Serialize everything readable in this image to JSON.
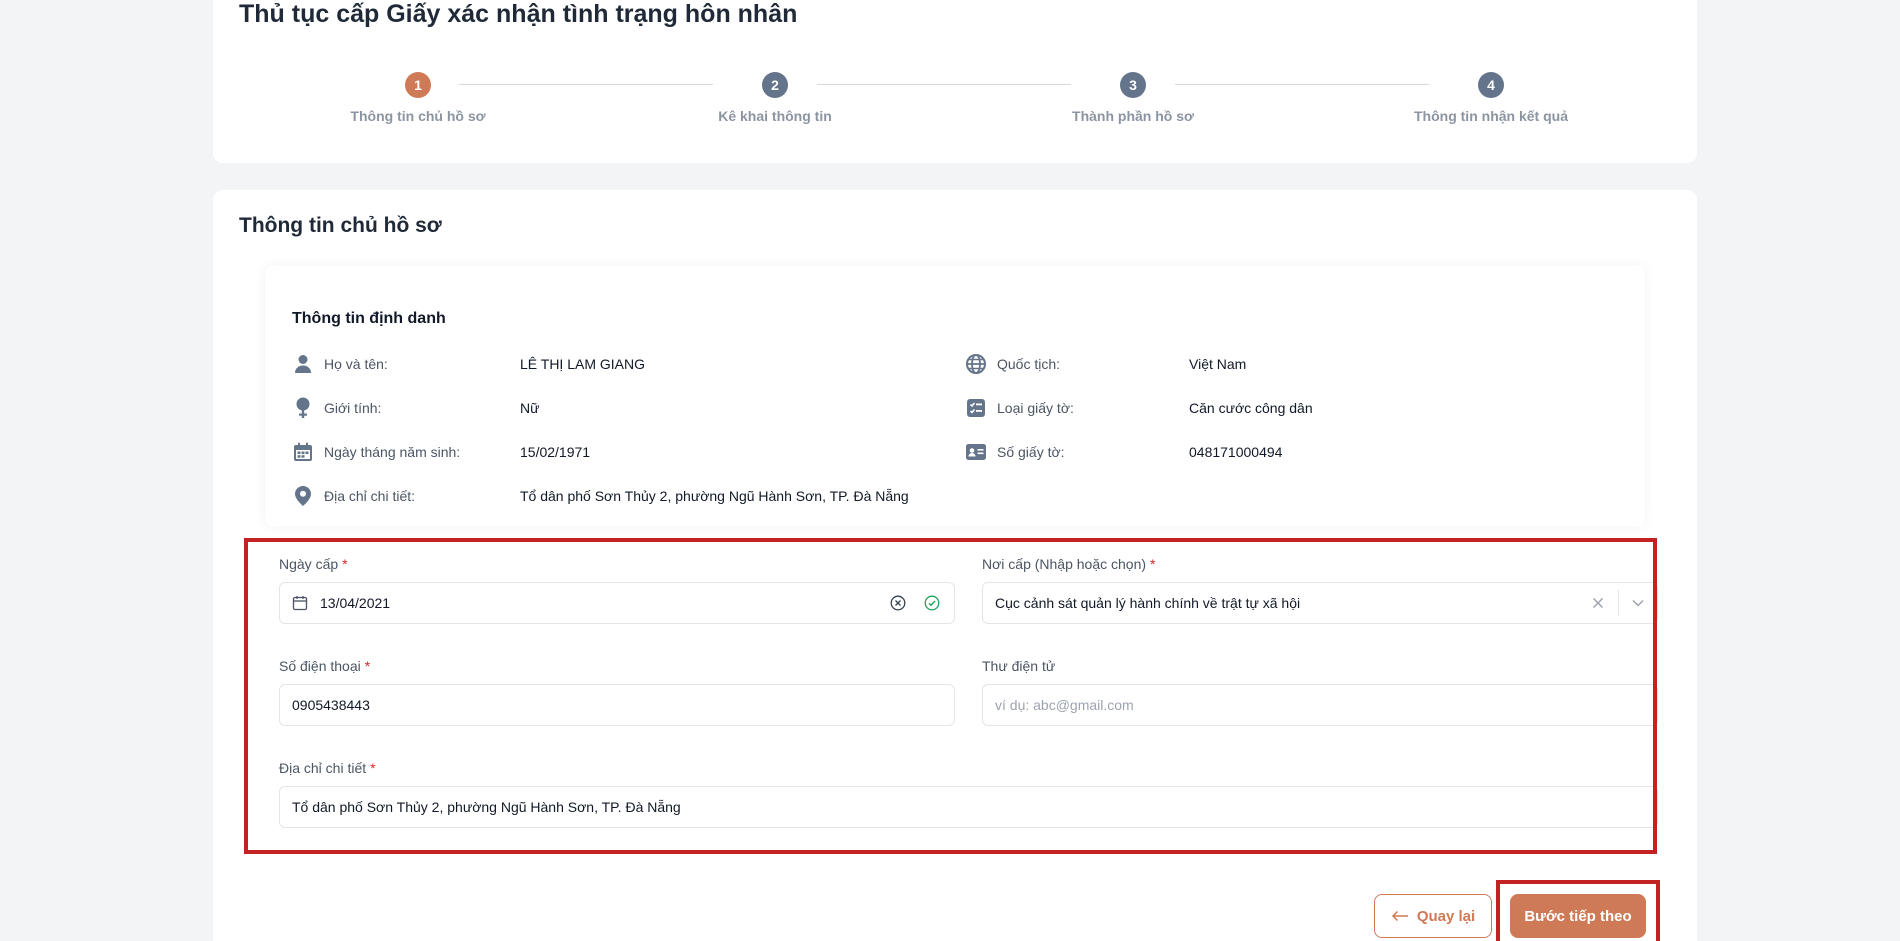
{
  "page": {
    "title": "Thủ tục cấp Giấy xác nhận tình trạng hôn nhân"
  },
  "stepper": {
    "steps": [
      {
        "number": "1",
        "label": "Thông tin chủ hồ sơ",
        "active": true
      },
      {
        "number": "2",
        "label": "Kê khai thông tin",
        "active": false
      },
      {
        "number": "3",
        "label": "Thành phần hồ sơ",
        "active": false
      },
      {
        "number": "4",
        "label": "Thông tin nhận kết quả",
        "active": false
      }
    ]
  },
  "section": {
    "title": "Thông tin chủ hồ sơ"
  },
  "identity": {
    "title": "Thông tin định danh",
    "full_name_label": "Họ và tên:",
    "full_name": "LÊ THỊ LAM GIANG",
    "gender_label": "Giới tính:",
    "gender": "Nữ",
    "dob_label": "Ngày tháng năm sinh:",
    "dob": "15/02/1971",
    "address_label": "Địa chỉ chi tiết:",
    "address": "Tổ dân phố Sơn Thủy 2, phường Ngũ Hành Sơn, TP. Đà Nẵng",
    "nationality_label": "Quốc tịch:",
    "nationality": "Việt Nam",
    "doc_type_label": "Loại giấy tờ:",
    "doc_type": "Căn cước công dân",
    "doc_number_label": "Số giấy tờ:",
    "doc_number": "048171000494"
  },
  "form": {
    "issue_date_label": "Ngày cấp",
    "issue_date_value": "13/04/2021",
    "issue_place_label": "Nơi cấp (Nhập hoặc chọn)",
    "issue_place_value": "Cục cảnh sát quản lý hành chính về trật tự xã hội",
    "phone_label": "Số điện thoại",
    "phone_value": "0905438443",
    "email_label": "Thư điện tử",
    "email_placeholder": "ví dụ: abc@gmail.com",
    "email_value": "",
    "address_label": "Địa chỉ chi tiết",
    "address_value": "Tổ dân phố Sơn Thủy 2, phường Ngũ Hành Sơn, TP. Đà Nẵng",
    "required_mark": "*"
  },
  "actions": {
    "back_label": "Quay lại",
    "next_label": "Bước tiếp theo"
  },
  "colors": {
    "accent": "#cf7a57",
    "step_inactive": "#64748b",
    "highlight": "#c32222"
  }
}
